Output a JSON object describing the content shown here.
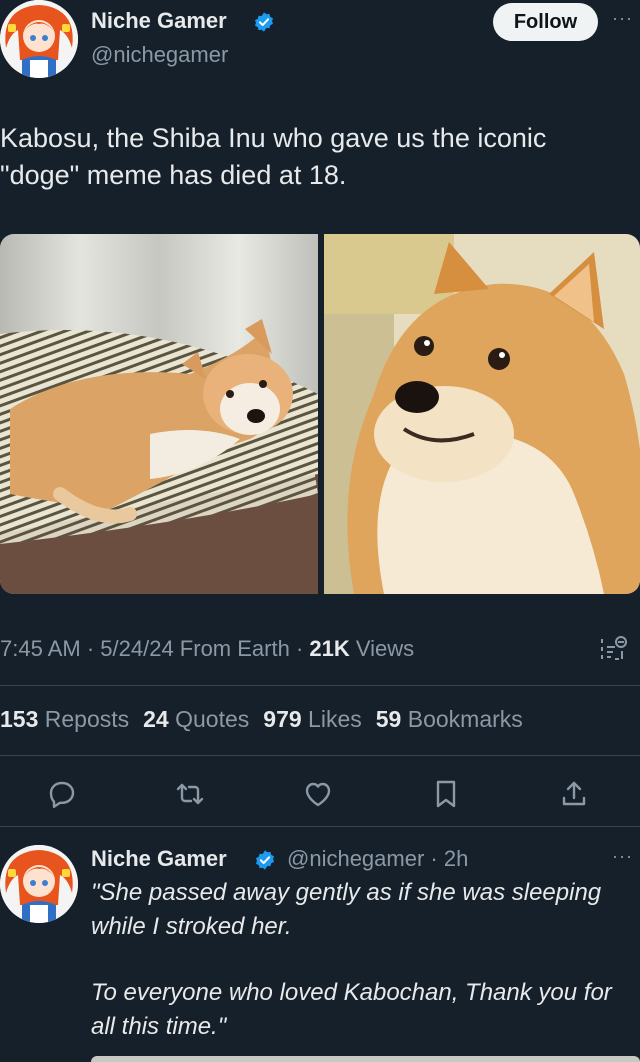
{
  "author": {
    "name": "Niche Gamer",
    "handle": "@nichegamer"
  },
  "follow_label": "Follow",
  "more_label": "···",
  "tweet_text": "Kabosu, the Shiba Inu who gave us the iconic \"doge\" meme has died at 18.",
  "meta": {
    "time": "7:45 AM",
    "sep1": " · ",
    "date": "5/24/24",
    "location": " From Earth",
    "sep2": " · ",
    "views_count": "21K",
    "views_label": " Views"
  },
  "stats": [
    {
      "count": "153",
      "label": " Reposts"
    },
    {
      "count": "24",
      "label": " Quotes"
    },
    {
      "count": "979",
      "label": " Likes"
    },
    {
      "count": "59",
      "label": " Bookmarks"
    }
  ],
  "actions": [
    "reply-icon",
    "repost-icon",
    "like-icon",
    "bookmark-icon",
    "share-icon"
  ],
  "reply": {
    "name": "Niche Gamer",
    "handle_time": "@nichegamer · 2h",
    "line1": "\"She passed away gently as if she was sleeping while I stroked her.",
    "line2": "To everyone who loved Kabochan, Thank you for all this time.\""
  },
  "colors": {
    "background": "#15202b",
    "text": "#e7e9ea",
    "muted": "#8b98a5",
    "verified": "#1d9bf0",
    "divider": "#38444d"
  }
}
